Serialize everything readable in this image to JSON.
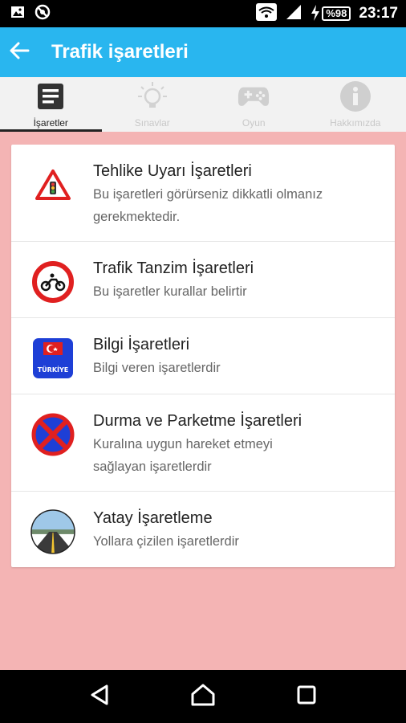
{
  "status_bar": {
    "time": "23:17",
    "battery": "%98",
    "icons": [
      "image-icon",
      "blocked-icon",
      "wifi-icon",
      "signal-icon",
      "charging-icon"
    ]
  },
  "app_bar": {
    "title": "Trafik işaretleri",
    "back_icon": "arrow-left-icon",
    "color": "#29b6ef"
  },
  "tabs": [
    {
      "label": "İşaretler",
      "icon": "document-icon",
      "active": true
    },
    {
      "label": "Sınavlar",
      "icon": "lightbulb-icon",
      "active": false
    },
    {
      "label": "Oyun",
      "icon": "gamepad-icon",
      "active": false
    },
    {
      "label": "Hakkımızda",
      "icon": "info-icon",
      "active": false
    }
  ],
  "items": [
    {
      "title": "Tehlike Uyarı İşaretleri",
      "subtitle": "Bu işaretleri görürseniz dikkatli olmanız gerekmektedir.",
      "icon": "warning-triangle-icon"
    },
    {
      "title": "Trafik Tanzim İşaretleri",
      "subtitle": "Bu işaretler kurallar belirtir",
      "icon": "no-motorcycle-sign-icon"
    },
    {
      "title": "Bilgi İşaretleri",
      "subtitle": "Bilgi veren işaretlerdir",
      "icon": "turkiye-sign-icon",
      "sign_text": "TÜRKİYE"
    },
    {
      "title": "Durma ve Parketme İşaretleri",
      "subtitle": "Kuralına uygun hareket etmeyi sağlayan işaretlerdir",
      "icon": "no-stopping-sign-icon"
    },
    {
      "title": "Yatay İşaretleme",
      "subtitle": "Yollara çizilen işaretlerdir",
      "icon": "road-icon"
    }
  ],
  "nav_bar": {
    "icons": [
      "back-triangle-icon",
      "home-icon",
      "recents-square-icon"
    ]
  },
  "colors": {
    "background": "#f4b4b4",
    "accent": "#29b6ef"
  }
}
